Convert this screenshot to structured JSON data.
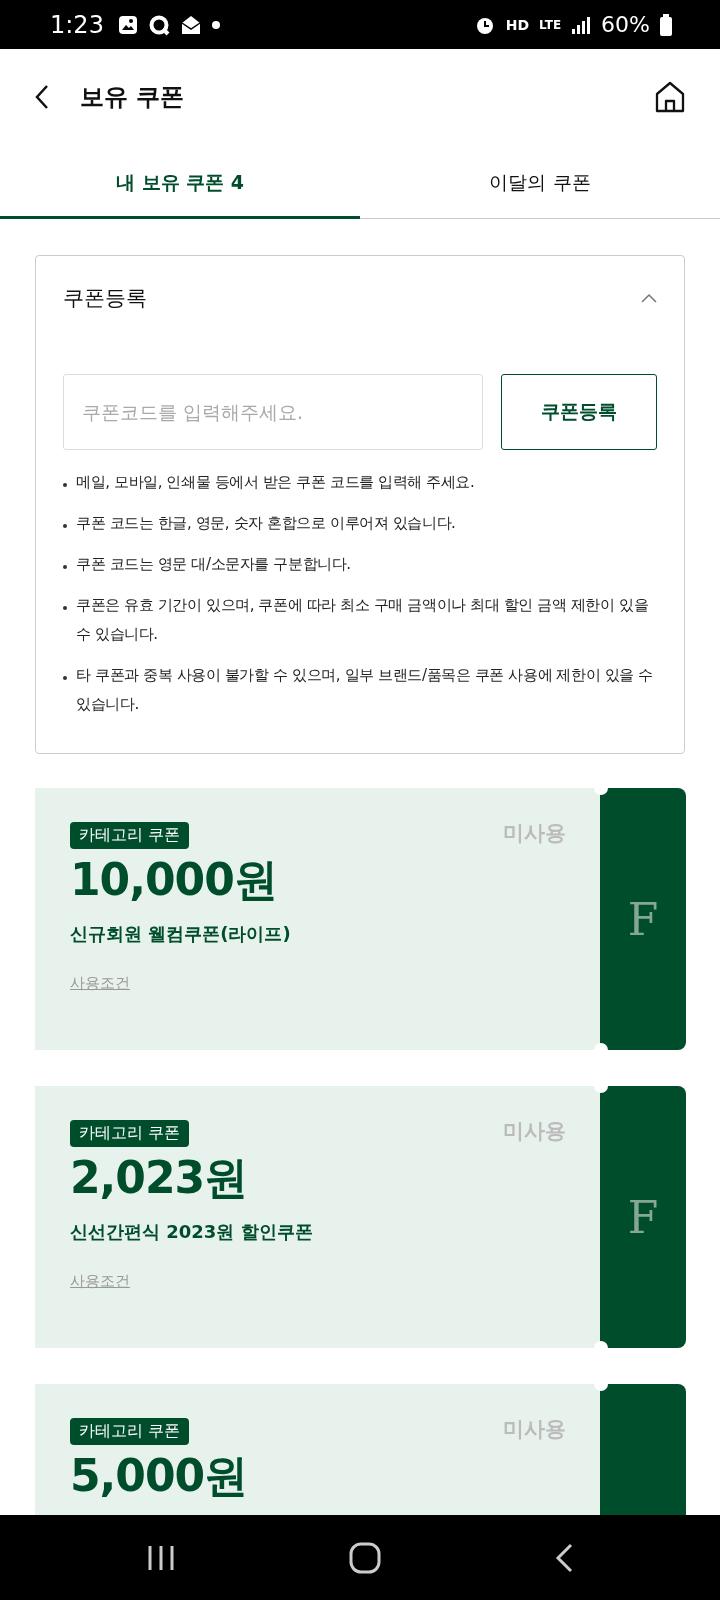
{
  "status_bar": {
    "time": "1:23",
    "voice": "HD",
    "network": "LTE",
    "battery": "60%"
  },
  "header": {
    "title": "보유 쿠폰"
  },
  "tabs": [
    {
      "label": "내 보유 쿠폰 4",
      "selected": true
    },
    {
      "label": "이달의 쿠폰",
      "selected": false
    }
  ],
  "register": {
    "title": "쿠폰등록",
    "expanded": true,
    "placeholder": "쿠폰코드를 입력해주세요.",
    "button": "쿠폰등록",
    "notes": [
      "메일, 모바일, 인쇄물 등에서 받은 쿠폰 코드를 입력해 주세요.",
      "쿠폰 코드는 한글, 영문, 숫자 혼합으로 이루어져 있습니다.",
      "쿠폰 코드는 영문 대/소문자를 구분합니다.",
      "쿠폰은 유효 기간이 있으며, 쿠폰에 따라 최소 구매 금액이나 최대 할인 금액 제한이 있을 수 있습니다.",
      "타 쿠폰과 중복 사용이 불가할 수 있으며, 일부 브랜드/품목은 쿠폰 사용에 제한이 있을 수 있습니다."
    ]
  },
  "coupons": [
    {
      "badge": "카테고리 쿠폰",
      "status": "미사용",
      "amount": "10,000원",
      "name": "신규회원 웰컴쿠폰(라이프)",
      "terms": "사용조건",
      "logo": "F"
    },
    {
      "badge": "카테고리 쿠폰",
      "status": "미사용",
      "amount": "2,023원",
      "name": "신선간편식 2023원 할인쿠폰",
      "terms": "사용조건",
      "logo": "F"
    },
    {
      "badge": "카테고리 쿠폰",
      "status": "미사용",
      "amount": "5,000원"
    }
  ]
}
